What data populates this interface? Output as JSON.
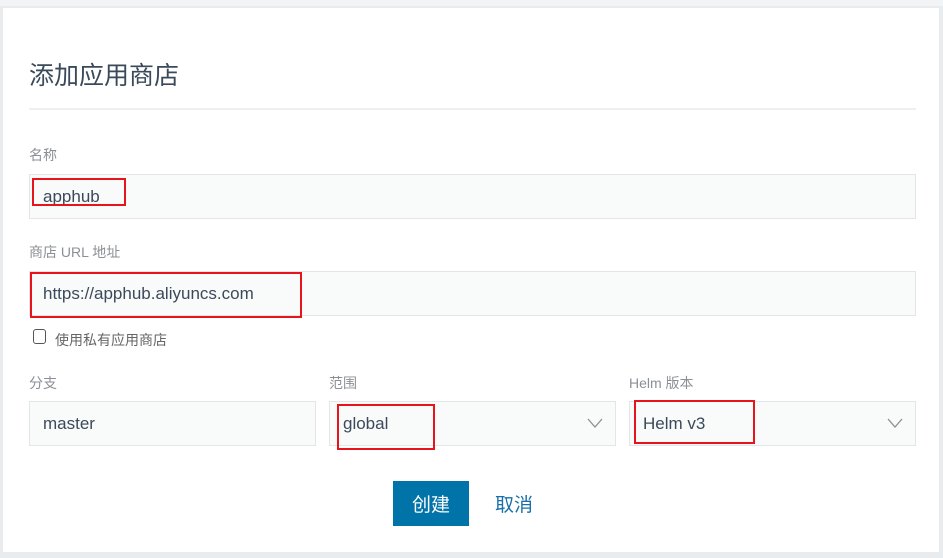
{
  "dialog": {
    "title": "添加应用商店"
  },
  "fields": {
    "name": {
      "label": "名称",
      "value": "apphub"
    },
    "url": {
      "label": "商店 URL 地址",
      "value": "https://apphub.aliyuncs.com"
    },
    "private": {
      "label": "使用私有应用商店",
      "checked": false
    },
    "branch": {
      "label": "分支",
      "value": "master"
    },
    "scope": {
      "label": "范围",
      "value": "global"
    },
    "helm": {
      "label": "Helm 版本",
      "value": "Helm v3"
    }
  },
  "buttons": {
    "create": "创建",
    "cancel": "取消"
  },
  "colors": {
    "primary": "#0073a8",
    "highlight": "#e8141b"
  }
}
